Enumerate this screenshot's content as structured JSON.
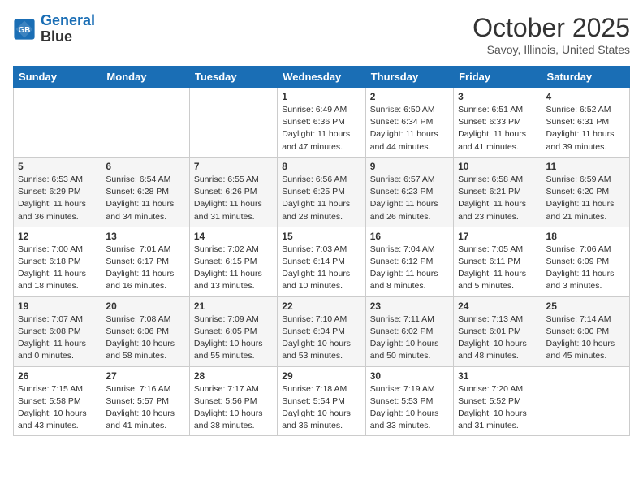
{
  "header": {
    "logo_line1": "General",
    "logo_line2": "Blue",
    "month": "October 2025",
    "location": "Savoy, Illinois, United States"
  },
  "weekdays": [
    "Sunday",
    "Monday",
    "Tuesday",
    "Wednesday",
    "Thursday",
    "Friday",
    "Saturday"
  ],
  "weeks": [
    [
      {
        "day": "",
        "info": ""
      },
      {
        "day": "",
        "info": ""
      },
      {
        "day": "",
        "info": ""
      },
      {
        "day": "1",
        "info": "Sunrise: 6:49 AM\nSunset: 6:36 PM\nDaylight: 11 hours and 47 minutes."
      },
      {
        "day": "2",
        "info": "Sunrise: 6:50 AM\nSunset: 6:34 PM\nDaylight: 11 hours and 44 minutes."
      },
      {
        "day": "3",
        "info": "Sunrise: 6:51 AM\nSunset: 6:33 PM\nDaylight: 11 hours and 41 minutes."
      },
      {
        "day": "4",
        "info": "Sunrise: 6:52 AM\nSunset: 6:31 PM\nDaylight: 11 hours and 39 minutes."
      }
    ],
    [
      {
        "day": "5",
        "info": "Sunrise: 6:53 AM\nSunset: 6:29 PM\nDaylight: 11 hours and 36 minutes."
      },
      {
        "day": "6",
        "info": "Sunrise: 6:54 AM\nSunset: 6:28 PM\nDaylight: 11 hours and 34 minutes."
      },
      {
        "day": "7",
        "info": "Sunrise: 6:55 AM\nSunset: 6:26 PM\nDaylight: 11 hours and 31 minutes."
      },
      {
        "day": "8",
        "info": "Sunrise: 6:56 AM\nSunset: 6:25 PM\nDaylight: 11 hours and 28 minutes."
      },
      {
        "day": "9",
        "info": "Sunrise: 6:57 AM\nSunset: 6:23 PM\nDaylight: 11 hours and 26 minutes."
      },
      {
        "day": "10",
        "info": "Sunrise: 6:58 AM\nSunset: 6:21 PM\nDaylight: 11 hours and 23 minutes."
      },
      {
        "day": "11",
        "info": "Sunrise: 6:59 AM\nSunset: 6:20 PM\nDaylight: 11 hours and 21 minutes."
      }
    ],
    [
      {
        "day": "12",
        "info": "Sunrise: 7:00 AM\nSunset: 6:18 PM\nDaylight: 11 hours and 18 minutes."
      },
      {
        "day": "13",
        "info": "Sunrise: 7:01 AM\nSunset: 6:17 PM\nDaylight: 11 hours and 16 minutes."
      },
      {
        "day": "14",
        "info": "Sunrise: 7:02 AM\nSunset: 6:15 PM\nDaylight: 11 hours and 13 minutes."
      },
      {
        "day": "15",
        "info": "Sunrise: 7:03 AM\nSunset: 6:14 PM\nDaylight: 11 hours and 10 minutes."
      },
      {
        "day": "16",
        "info": "Sunrise: 7:04 AM\nSunset: 6:12 PM\nDaylight: 11 hours and 8 minutes."
      },
      {
        "day": "17",
        "info": "Sunrise: 7:05 AM\nSunset: 6:11 PM\nDaylight: 11 hours and 5 minutes."
      },
      {
        "day": "18",
        "info": "Sunrise: 7:06 AM\nSunset: 6:09 PM\nDaylight: 11 hours and 3 minutes."
      }
    ],
    [
      {
        "day": "19",
        "info": "Sunrise: 7:07 AM\nSunset: 6:08 PM\nDaylight: 11 hours and 0 minutes."
      },
      {
        "day": "20",
        "info": "Sunrise: 7:08 AM\nSunset: 6:06 PM\nDaylight: 10 hours and 58 minutes."
      },
      {
        "day": "21",
        "info": "Sunrise: 7:09 AM\nSunset: 6:05 PM\nDaylight: 10 hours and 55 minutes."
      },
      {
        "day": "22",
        "info": "Sunrise: 7:10 AM\nSunset: 6:04 PM\nDaylight: 10 hours and 53 minutes."
      },
      {
        "day": "23",
        "info": "Sunrise: 7:11 AM\nSunset: 6:02 PM\nDaylight: 10 hours and 50 minutes."
      },
      {
        "day": "24",
        "info": "Sunrise: 7:13 AM\nSunset: 6:01 PM\nDaylight: 10 hours and 48 minutes."
      },
      {
        "day": "25",
        "info": "Sunrise: 7:14 AM\nSunset: 6:00 PM\nDaylight: 10 hours and 45 minutes."
      }
    ],
    [
      {
        "day": "26",
        "info": "Sunrise: 7:15 AM\nSunset: 5:58 PM\nDaylight: 10 hours and 43 minutes."
      },
      {
        "day": "27",
        "info": "Sunrise: 7:16 AM\nSunset: 5:57 PM\nDaylight: 10 hours and 41 minutes."
      },
      {
        "day": "28",
        "info": "Sunrise: 7:17 AM\nSunset: 5:56 PM\nDaylight: 10 hours and 38 minutes."
      },
      {
        "day": "29",
        "info": "Sunrise: 7:18 AM\nSunset: 5:54 PM\nDaylight: 10 hours and 36 minutes."
      },
      {
        "day": "30",
        "info": "Sunrise: 7:19 AM\nSunset: 5:53 PM\nDaylight: 10 hours and 33 minutes."
      },
      {
        "day": "31",
        "info": "Sunrise: 7:20 AM\nSunset: 5:52 PM\nDaylight: 10 hours and 31 minutes."
      },
      {
        "day": "",
        "info": ""
      }
    ]
  ]
}
